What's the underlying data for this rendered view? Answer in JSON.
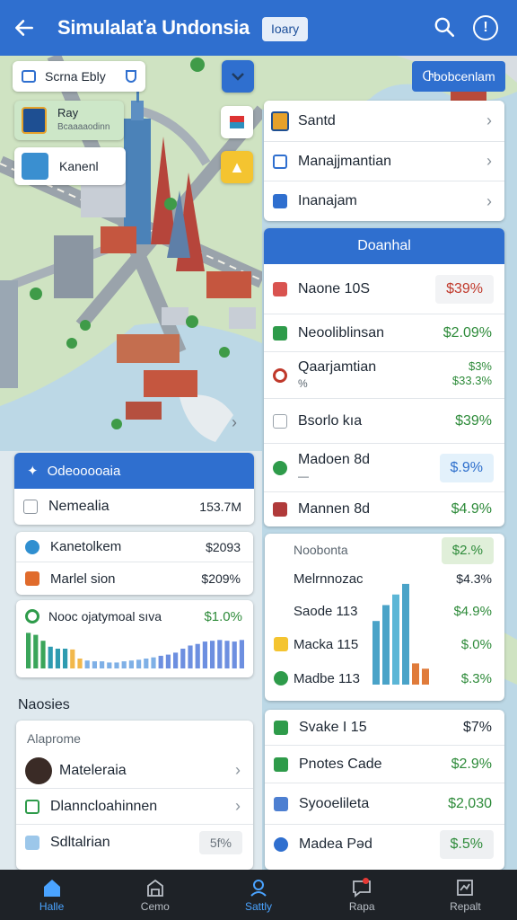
{
  "appbar": {
    "title": "Simulalaťa Undonsia",
    "badge": "Ioary"
  },
  "map": {
    "chip_city": "Scrna Ebly",
    "card_top": {
      "title": "Ray",
      "subtitle": "Bcaaaaodinn"
    },
    "card_bottom": {
      "title": "Kanenl"
    }
  },
  "top_right_button": "Ⴇbobcenlam",
  "menu": [
    {
      "label": "Santd"
    },
    {
      "label": "Manajjmantian"
    },
    {
      "label": "Inanajam"
    }
  ],
  "overview": {
    "header": "Doanhal",
    "rows": [
      {
        "label": "Naone 10S",
        "value": "$39%"
      },
      {
        "label": "Neooliblinsan",
        "value": "$2.09%"
      },
      {
        "label": "Qaarjamtian",
        "sub": "%",
        "value_top": "$3%",
        "value_bottom": "$33.3%"
      },
      {
        "label": "Bsorlo kıa",
        "value": "$39%"
      },
      {
        "label": "Madoen 8d",
        "sub": "—",
        "value": "$.9%"
      },
      {
        "label": "Mannen 8d",
        "value": "$4.9%"
      }
    ]
  },
  "left_panel": {
    "header": "Odeooooaia",
    "summary": {
      "label": "Nemealia",
      "value": "153.7M"
    },
    "rows": [
      {
        "label": "Kanetolkem",
        "value": "$2093"
      },
      {
        "label": "Marlel sion",
        "value": "$209%"
      }
    ],
    "chart_title": "Nooc ojatymoal sıva",
    "chart_value": "$1.0%"
  },
  "bars_left": [
    0.9,
    0.85,
    0.7,
    0.55,
    0.5,
    0.5,
    0.48,
    0.25,
    0.2,
    0.18,
    0.18,
    0.15,
    0.15,
    0.18,
    0.2,
    0.22,
    0.25,
    0.28,
    0.32,
    0.35,
    0.4,
    0.5,
    0.58,
    0.62,
    0.68,
    0.7,
    0.72,
    0.7,
    0.68,
    0.72
  ],
  "stats": {
    "title": "Noobonta",
    "badge": "$2.%",
    "rows": [
      {
        "label": "Melrnnozac",
        "value": "$4.3%"
      },
      {
        "label": "Saode 113",
        "value": "$4.9%"
      },
      {
        "label": "Macka 115",
        "value": "$.0%"
      },
      {
        "label": "Madbe 113",
        "value": "$.3%"
      }
    ]
  },
  "bars_right": [
    0.6,
    0.75,
    0.85,
    0.95,
    0.2,
    0.15
  ],
  "section_title": "Naosies",
  "people": {
    "header": "Alaprome",
    "rows": [
      {
        "label": "Mateleraia"
      },
      {
        "label": "Dlanncloahinnen"
      },
      {
        "label": "Sdltalrian",
        "value": "5f%"
      }
    ]
  },
  "bottom_right": {
    "rows": [
      {
        "label": "Svake I 15",
        "value": "$7%"
      },
      {
        "label": "Pnotes Cade",
        "value": "$2.9%"
      },
      {
        "label": "Syooelileta",
        "value": "$2,030"
      },
      {
        "label": "Madea Pəd",
        "value": "$.5%"
      }
    ]
  },
  "nav": [
    {
      "label": "Halle"
    },
    {
      "label": "Cemo"
    },
    {
      "label": "Sattly"
    },
    {
      "label": "Rapa"
    },
    {
      "label": "Repalt"
    }
  ],
  "colors": {
    "primary": "#2f6fcf",
    "positive": "#2e8b3a",
    "negative": "#c0392b",
    "nav_active": "#4aa3ff"
  }
}
